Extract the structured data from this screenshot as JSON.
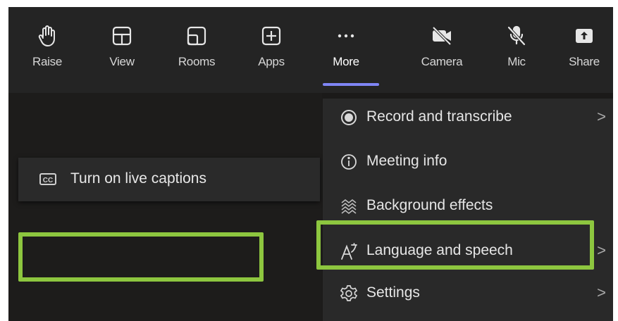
{
  "toolbar": {
    "buttons": [
      {
        "label": "Raise",
        "icon": "hand-raise-icon"
      },
      {
        "label": "View",
        "icon": "view-grid-icon"
      },
      {
        "label": "Rooms",
        "icon": "breakout-rooms-icon"
      },
      {
        "label": "Apps",
        "icon": "apps-add-icon"
      },
      {
        "label": "More",
        "icon": "more-dots-icon"
      },
      {
        "label": "Camera",
        "icon": "camera-off-icon"
      },
      {
        "label": "Mic",
        "icon": "mic-off-icon"
      },
      {
        "label": "Share",
        "icon": "share-icon"
      }
    ],
    "active": "More",
    "accent": "#7f85f5"
  },
  "captions": {
    "label": "Turn on live captions",
    "icon": "closed-captions-icon"
  },
  "menu": {
    "items": [
      {
        "label": "Record and transcribe",
        "icon": "record-icon",
        "chevron": ">"
      },
      {
        "label": "Meeting info",
        "icon": "info-icon",
        "chevron": ""
      },
      {
        "label": "Background effects",
        "icon": "background-effects-icon",
        "chevron": ""
      },
      {
        "label": "Language and speech",
        "icon": "language-icon",
        "chevron": ">"
      },
      {
        "label": "Settings",
        "icon": "settings-gear-icon",
        "chevron": ">"
      }
    ]
  },
  "highlight_color": "#8dc63f"
}
